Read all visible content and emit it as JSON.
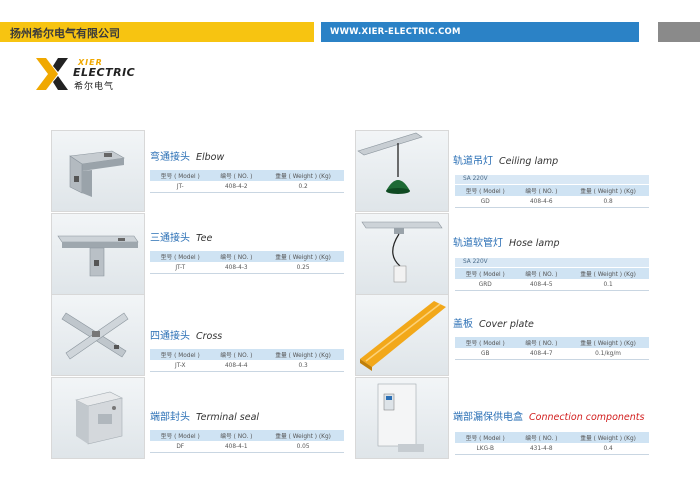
{
  "header": {
    "company": "扬州希尔电气有限公司",
    "website": "WWW.XIER-ELECTRIC.COM",
    "colors": {
      "yellow": "#f7c411",
      "blue": "#2b82c6",
      "grey": "#8a8a8a"
    }
  },
  "logo": {
    "top": "XIER",
    "main": "ELECTRIC",
    "cn": "希尔电气"
  },
  "products": [
    {
      "cn": "弯通接头",
      "en": "Elbow",
      "h1": "型号 ( Model )",
      "h2": "编号 ( NO. )",
      "h3": "重量 ( Weight ) (Kg)",
      "model": "JT-",
      "no": "408-4-2",
      "weight": "0.2"
    },
    {
      "cn": "三通接头",
      "en": "Tee",
      "h1": "型号 ( Model )",
      "h2": "编号 ( NO. )",
      "h3": "重量 ( Weight ) (Kg)",
      "model": "JT-T",
      "no": "408-4-3",
      "weight": "0.25"
    },
    {
      "cn": "四通接头",
      "en": "Cross",
      "h1": "型号 ( Model )",
      "h2": "编号 ( NO. )",
      "h3": "重量 ( Weight ) (Kg)",
      "model": "JT-X",
      "no": "408-4-4",
      "weight": "0.3"
    },
    {
      "cn": "端部封头",
      "en": "Terminal seal",
      "h1": "型号 ( Model )",
      "h2": "编号 ( NO. )",
      "h3": "重量 ( Weight ) (Kg)",
      "model": "DF",
      "no": "408-4-1",
      "weight": "0.05"
    },
    {
      "cn": "轨道吊灯",
      "en": "Ceiling lamp",
      "volt": "SA  220V",
      "h1": "型号 ( Model )",
      "h2": "编号 ( NO. )",
      "h3": "重量 ( Weight ) (Kg)",
      "model": "GD",
      "no": "408-4-6",
      "weight": "0.8"
    },
    {
      "cn": "轨道软管灯",
      "en": "Hose lamp",
      "volt": "SA  220V",
      "h1": "型号 ( Model )",
      "h2": "编号 ( NO. )",
      "h3": "重量 ( Weight ) (Kg)",
      "model": "GRD",
      "no": "408-4-5",
      "weight": "0.1"
    },
    {
      "cn": "盖板",
      "en": "Cover plate",
      "h1": "型号 ( Model )",
      "h2": "编号 ( NO. )",
      "h3": "重量 ( Weight ) (Kg)",
      "model": "GB",
      "no": "408-4-7",
      "weight": "0.1/kg/m"
    },
    {
      "cn": "端部漏保供电盒",
      "en": "Connection components",
      "h1": "型号 ( Model )",
      "h2": "编号 ( NO. )",
      "h3": "重量 ( Weight ) (Kg)",
      "model": "LKG-B",
      "no": "431-4-8",
      "weight": "0.4"
    }
  ]
}
